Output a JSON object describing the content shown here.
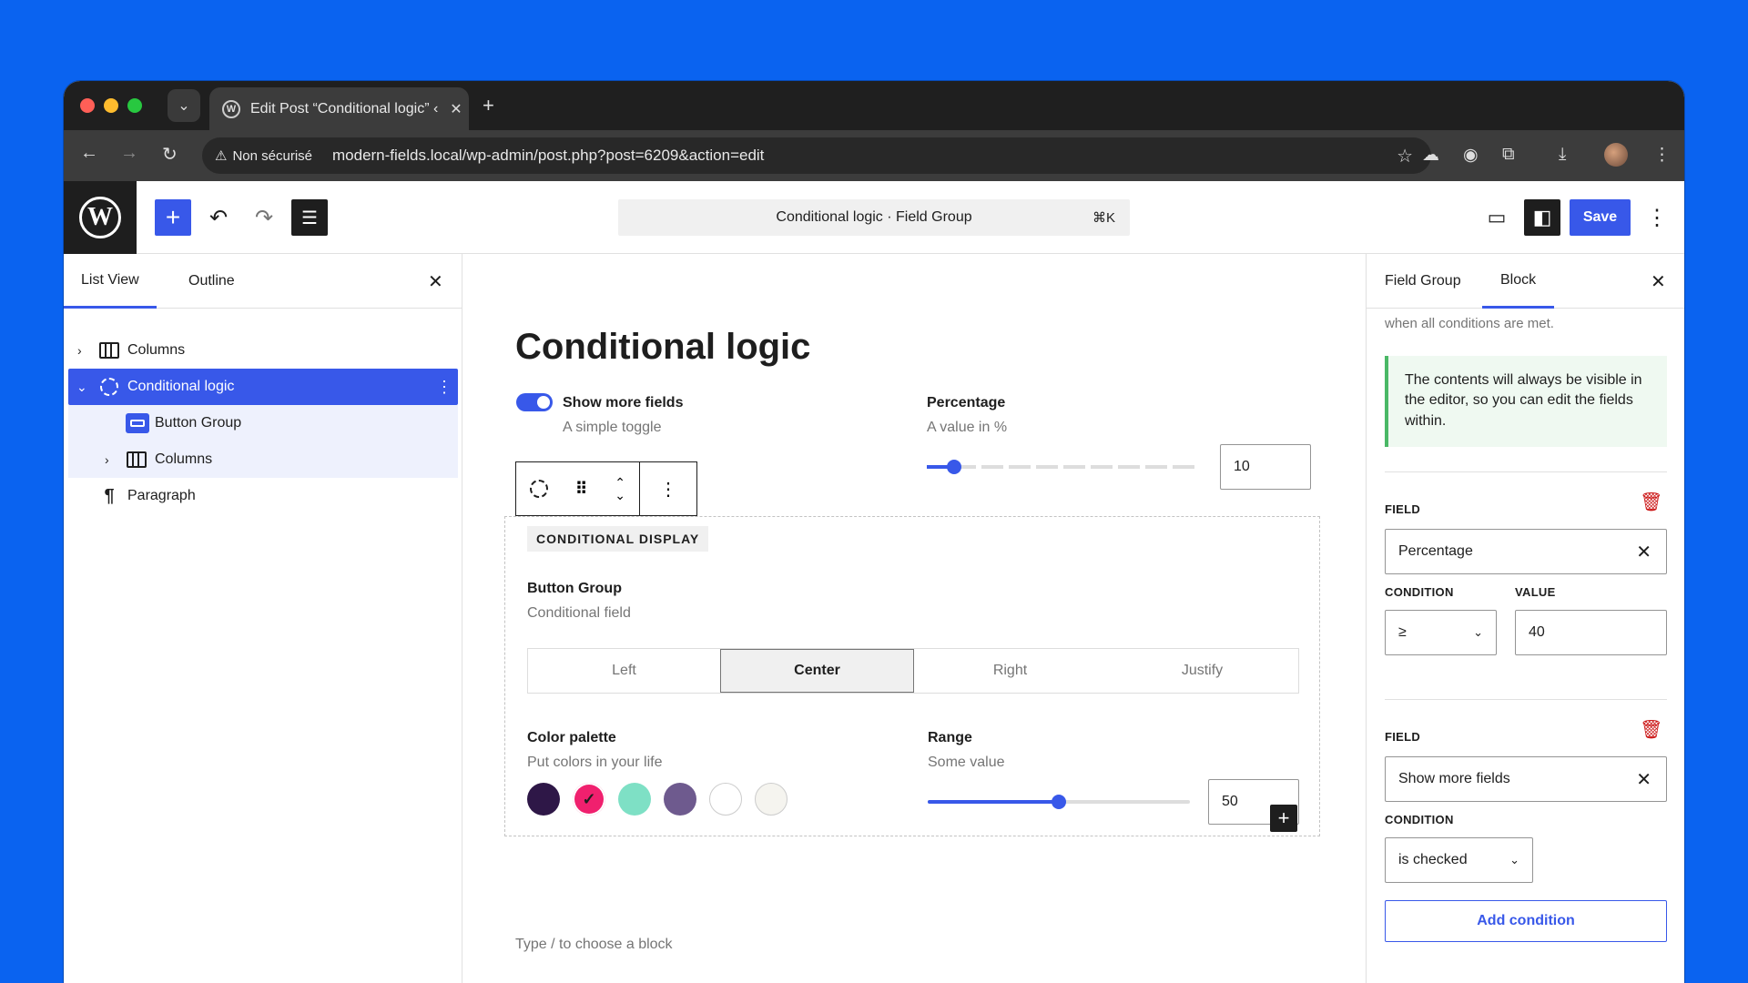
{
  "browser": {
    "tab_title": "Edit Post “Conditional logic” ‹",
    "security_label": "Non sécurisé",
    "url": "modern-fields.local/wp-admin/post.php?post=6209&action=edit"
  },
  "toolbar": {
    "command_label": "Conditional logic · Field Group",
    "command_shortcut": "⌘K",
    "save_label": "Save"
  },
  "left_panel": {
    "tabs": [
      "List View",
      "Outline"
    ],
    "items": [
      {
        "label": "Columns"
      },
      {
        "label": "Conditional logic"
      },
      {
        "label": "Button Group"
      },
      {
        "label": "Columns"
      },
      {
        "label": "Paragraph"
      }
    ]
  },
  "canvas": {
    "title": "Conditional logic",
    "toggle": {
      "label": "Show more fields",
      "help": "A simple toggle",
      "checked": true
    },
    "percentage": {
      "label": "Percentage",
      "help": "A value in %",
      "value": "10"
    },
    "conditional_tag": "CONDITIONAL DISPLAY",
    "button_group": {
      "label": "Button Group",
      "help": "Conditional field",
      "options": [
        "Left",
        "Center",
        "Right",
        "Justify"
      ],
      "selected": "Center"
    },
    "color_palette": {
      "label": "Color palette",
      "help": "Put colors in your life",
      "colors": [
        "#2e1747",
        "#f0206e",
        "#7ee0c5",
        "#6e5a8e",
        "#ffffff",
        "#f5f4ef"
      ],
      "selected_index": 1
    },
    "range": {
      "label": "Range",
      "help": "Some value",
      "value": "50",
      "fraction": 0.5
    },
    "placeholder": "Type / to choose a block"
  },
  "right_panel": {
    "tabs": [
      "Field Group",
      "Block"
    ],
    "intro": "when all conditions are met.",
    "notice": "The contents will always be visible in the editor, so you can edit the fields within.",
    "conditions": [
      {
        "field_label": "FIELD",
        "field": "Percentage",
        "condition_label": "CONDITION",
        "condition": "≥",
        "value_label": "VALUE",
        "value": "40"
      },
      {
        "field_label": "FIELD",
        "field": "Show more fields",
        "condition_label": "CONDITION",
        "condition": "is checked"
      }
    ],
    "add_condition": "Add condition"
  },
  "colors": {
    "accent": "#3858e9",
    "notice_border": "#4ab866",
    "danger": "#cc1818"
  }
}
